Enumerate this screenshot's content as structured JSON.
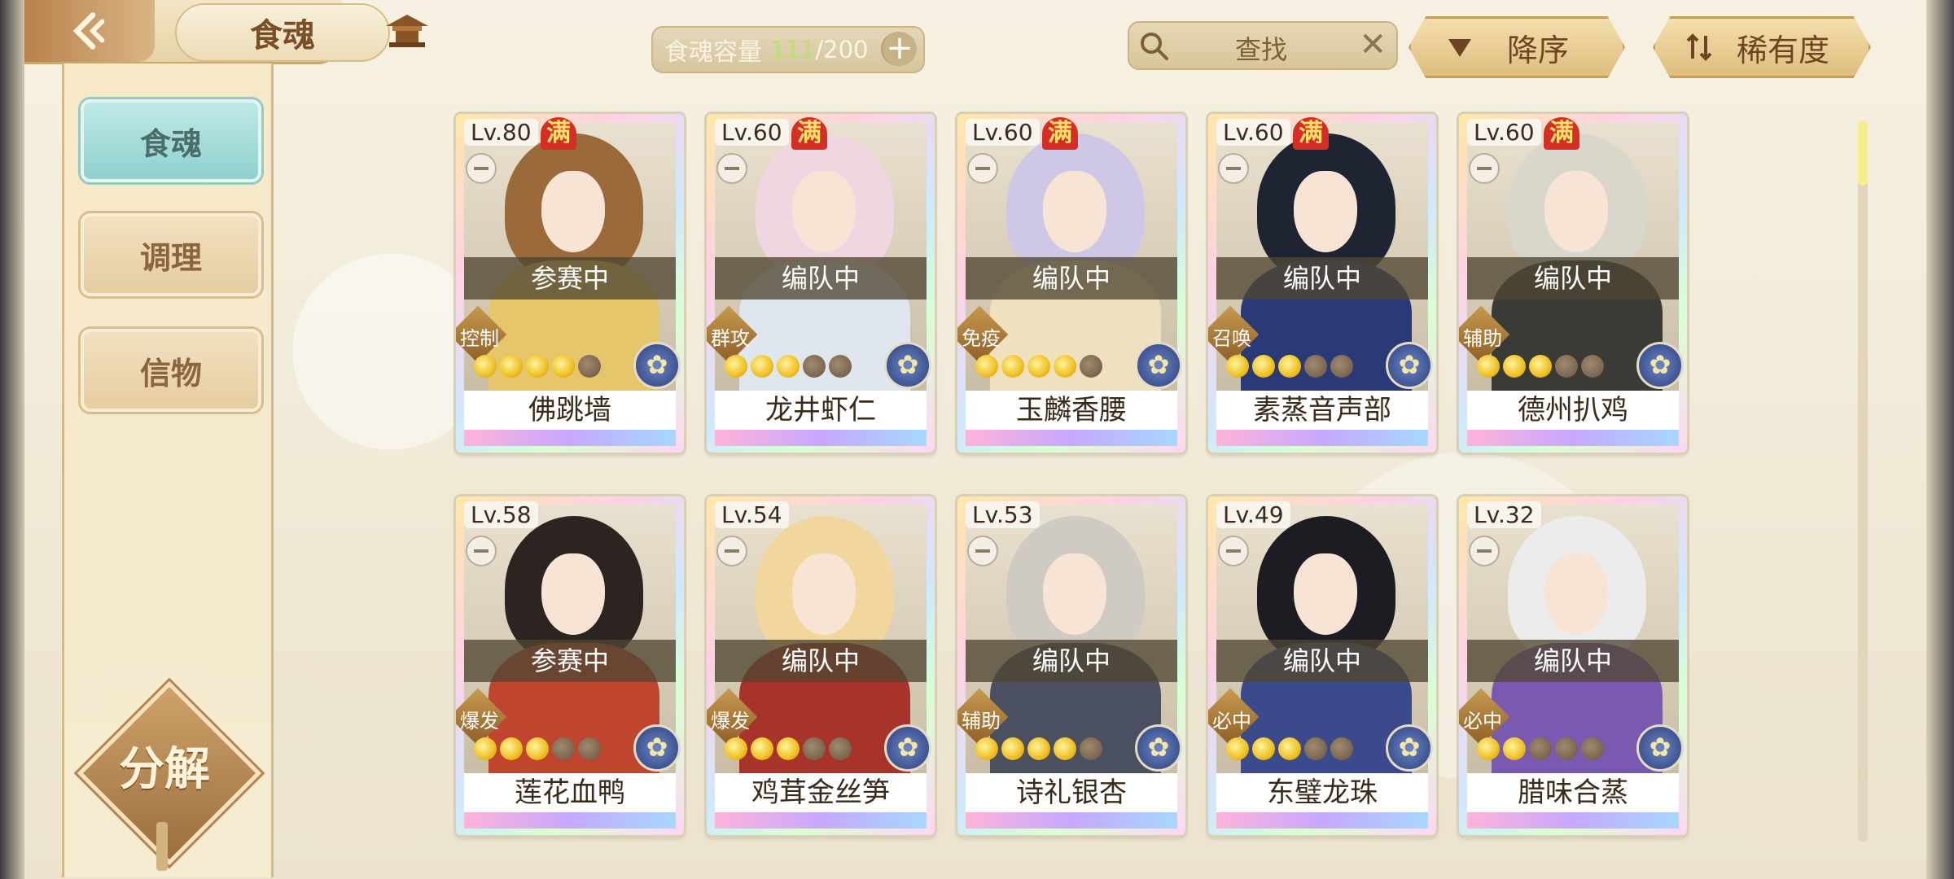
{
  "header": {
    "back_icon": "back-arrow-icon",
    "title": "食魂",
    "home_icon": "pavilion-home-icon",
    "capacity_label": "食魂容量",
    "capacity_current": "111",
    "capacity_max": "/200",
    "add_label": "+"
  },
  "search": {
    "placeholder": "查找",
    "clear": "✕"
  },
  "sort": {
    "order_label": "降序",
    "field_label": "稀有度"
  },
  "sidebar": {
    "items": [
      {
        "label": "食魂",
        "active": true
      },
      {
        "label": "调理",
        "active": false
      },
      {
        "label": "信物",
        "active": false
      }
    ],
    "decompose_label": "分解"
  },
  "full_badge": "满",
  "cards": [
    {
      "level": "Lv.80",
      "full": true,
      "status": "参赛中",
      "role": "控制",
      "stars": 4,
      "name": "佛跳墙",
      "hair": "#9a6a3a",
      "outfit": "#e5c66a"
    },
    {
      "level": "Lv.60",
      "full": true,
      "status": "编队中",
      "role": "群攻",
      "stars": 3,
      "name": "龙井虾仁",
      "hair": "#f0d6e0",
      "outfit": "#dfe6ee"
    },
    {
      "level": "Lv.60",
      "full": true,
      "status": "编队中",
      "role": "免疫",
      "stars": 4,
      "name": "玉麟香腰",
      "hair": "#cfc7e6",
      "outfit": "#efe1c0"
    },
    {
      "level": "Lv.60",
      "full": true,
      "status": "编队中",
      "role": "召唤",
      "stars": 3,
      "name": "素蒸音声部",
      "hair": "#1f2433",
      "outfit": "#2a3a78"
    },
    {
      "level": "Lv.60",
      "full": true,
      "status": "编队中",
      "role": "辅助",
      "stars": 3,
      "name": "德州扒鸡",
      "hair": "#d9d6cc",
      "outfit": "#3a3a36"
    },
    {
      "level": "Lv.58",
      "full": false,
      "status": "参赛中",
      "role": "爆发",
      "stars": 3,
      "name": "莲花血鸭",
      "hair": "#2b2420",
      "outfit": "#c0452e"
    },
    {
      "level": "Lv.54",
      "full": false,
      "status": "编队中",
      "role": "爆发",
      "stars": 3,
      "name": "鸡茸金丝笋",
      "hair": "#f1d79e",
      "outfit": "#a8332a"
    },
    {
      "level": "Lv.53",
      "full": false,
      "status": "编队中",
      "role": "辅助",
      "stars": 4,
      "name": "诗礼银杏",
      "hair": "#cfcac4",
      "outfit": "#4a5060"
    },
    {
      "level": "Lv.49",
      "full": false,
      "status": "编队中",
      "role": "必中",
      "stars": 3,
      "name": "东璧龙珠",
      "hair": "#1c1c22",
      "outfit": "#3b4a8a"
    },
    {
      "level": "Lv.32",
      "full": false,
      "status": "编队中",
      "role": "必中",
      "stars": 2,
      "name": "腊味合蒸",
      "hair": "#ececec",
      "outfit": "#7a5ab0"
    }
  ]
}
